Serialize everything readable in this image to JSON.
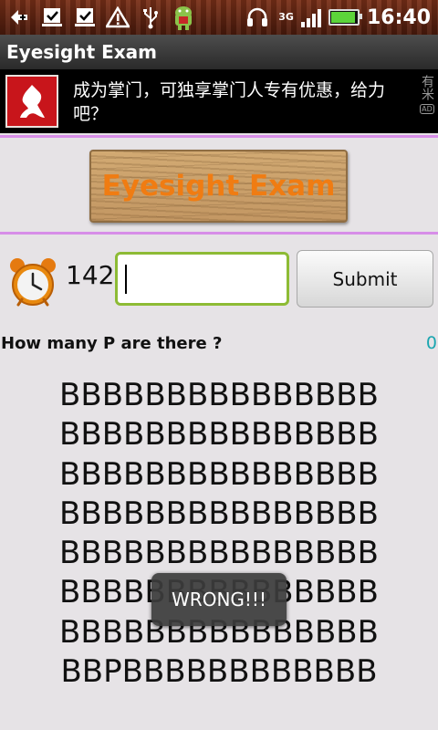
{
  "status_bar": {
    "time": "16:40",
    "network": "3G",
    "icons": [
      "back-arrow-icon",
      "download-done-icon",
      "download-done-icon",
      "warning-icon",
      "usb-icon",
      "android-icon",
      "headset-icon"
    ],
    "battery_level": 0.88
  },
  "app": {
    "title": "Eyesight Exam"
  },
  "ad": {
    "text": "成为掌门，可独享掌门人专有优惠，给力吧？",
    "side_text": "有米",
    "side_badge": "AD"
  },
  "sign": {
    "title": "Eyesight Exam"
  },
  "controls": {
    "timer": "142",
    "answer_value": "",
    "submit_label": "Submit"
  },
  "question": {
    "text": "How many P are there ?",
    "score": "0"
  },
  "grid": {
    "lines": [
      "BBBBBBBBBBBBBBB",
      "BBBBBBBBBBBBBBB",
      "BBBBBBBBBBBBBBB",
      "BBBBBBBBBBBBBBB",
      "BBBBBBBBBBBBBBB",
      "BBBBBBBBBBBBBBB",
      "BBBBBBBBBBBBBBB",
      "BBPBBBBBBBBBBBB"
    ]
  },
  "toast": {
    "text": "WRONG!!!"
  },
  "colors": {
    "accent": "#8dbb35",
    "score": "#1aa6b0",
    "sign_text": "#f07c12",
    "divider": "#d78ee8"
  }
}
